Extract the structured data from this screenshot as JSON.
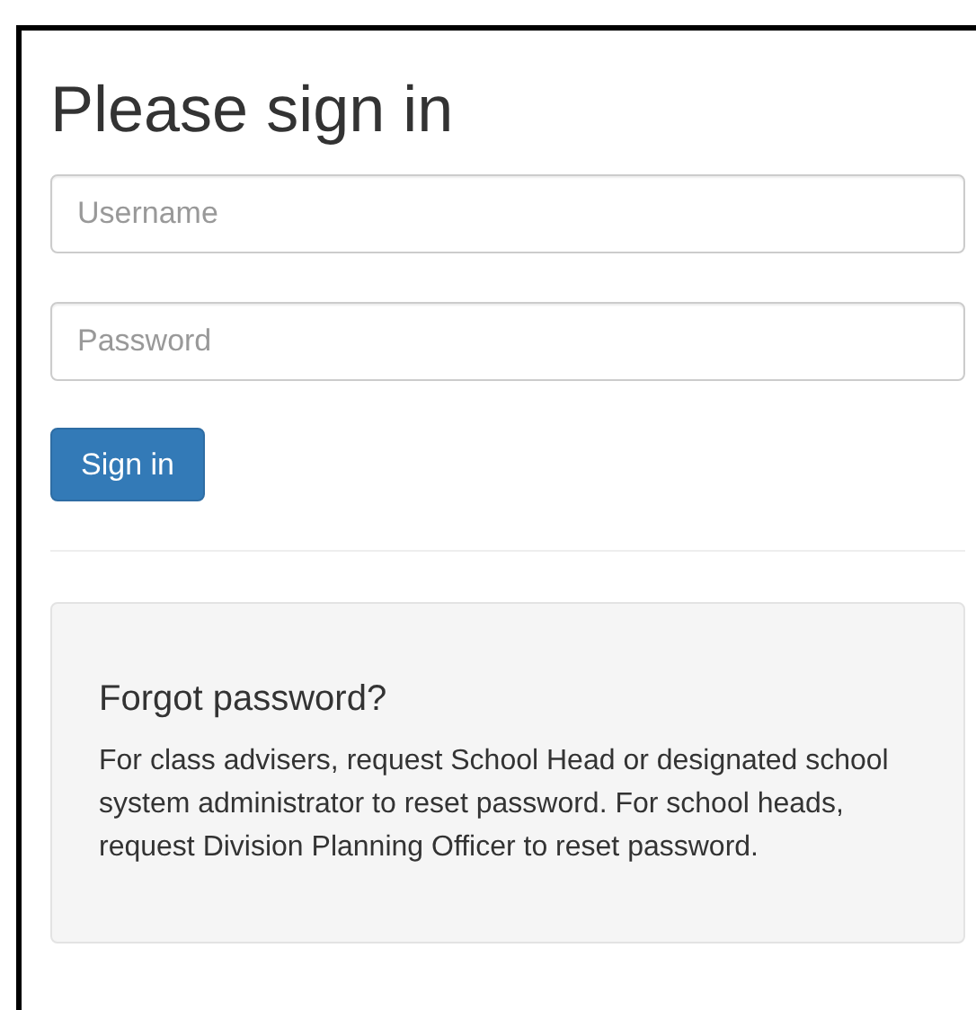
{
  "title": "Please sign in",
  "fields": [
    {
      "placeholder": "Username"
    },
    {
      "placeholder": "Password"
    }
  ],
  "button": "Sign in",
  "help": {
    "heading": "Forgot password?",
    "text": "For class advisers, request School Head or designated school system administrator to reset password. For school heads, request Division Planning Officer to reset password."
  }
}
